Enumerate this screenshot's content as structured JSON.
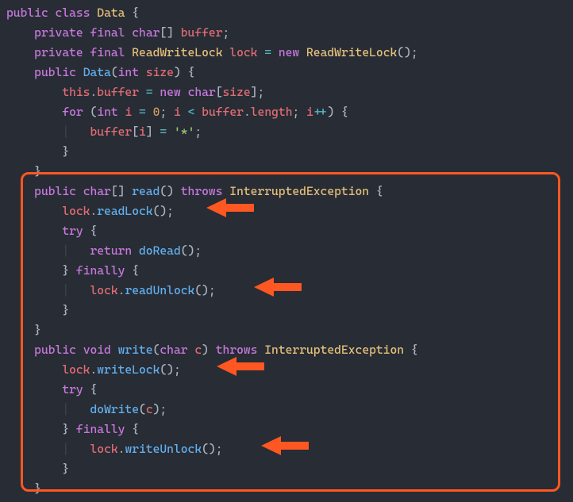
{
  "kw": {
    "public": "public",
    "class": "class",
    "private": "private",
    "final": "final",
    "new": "new",
    "for": "for",
    "int": "int",
    "char": "char",
    "void": "void",
    "return": "return",
    "try": "try",
    "finally": "finally",
    "throws": "throws",
    "this": "this"
  },
  "cls": {
    "Data": "Data",
    "ReadWriteLock": "ReadWriteLock",
    "InterruptedException": "InterruptedException"
  },
  "id": {
    "buffer": "buffer",
    "lock": "lock",
    "size": "size",
    "i": "i",
    "length": "length",
    "c": "c"
  },
  "mtd": {
    "DataCtor": "Data",
    "read": "read",
    "readLock": "readLock",
    "doRead": "doRead",
    "readUnlock": "readUnlock",
    "write": "write",
    "writeLock": "writeLock",
    "doWrite": "doWrite",
    "writeUnlock": "writeUnlock"
  },
  "lit": {
    "zero": "0",
    "star": "'*'"
  },
  "punct": {
    "lbrace": "{",
    "rbrace": "}",
    "lbracket": "[",
    "rbracket": "]",
    "lparen": "(",
    "rparen": ")",
    "semi": ";",
    "dot": ".",
    "comma": ",",
    "eq": "=",
    "lt": "<",
    "pp": "++",
    "brackets": "[]",
    "parens": "()",
    "guide": "|"
  },
  "colors": {
    "background": "#282c34",
    "highlight_border": "#ff5722",
    "arrow_fill": "#ff5722"
  },
  "annotations": [
    {
      "target": "lock.readLock()"
    },
    {
      "target": "lock.readUnlock()"
    },
    {
      "target": "lock.writeLock()"
    },
    {
      "target": "lock.writeUnlock()"
    }
  ]
}
